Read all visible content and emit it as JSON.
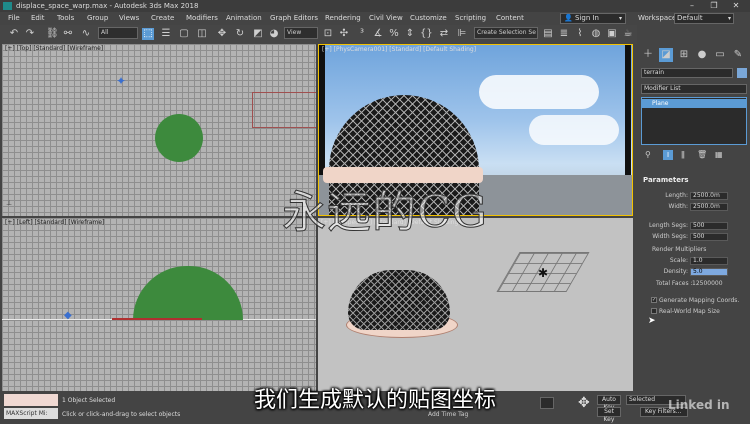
{
  "window": {
    "title": "displace_space_warp.max - Autodesk 3ds Max 2018",
    "minimize": "–",
    "restore": "❐",
    "close": "✕"
  },
  "menu": {
    "items": [
      "File",
      "Edit",
      "Tools",
      "Group",
      "Views",
      "Create",
      "Modifiers",
      "Animation",
      "Graph Editors",
      "Rendering",
      "Civil View",
      "Customize",
      "Scripting",
      "Content"
    ],
    "sign_in": "Sign In",
    "workspaces_label": "Workspaces:",
    "workspace_value": "Default"
  },
  "toolbar": {
    "filter_value": "All",
    "view_value": "View",
    "selection_set": "Create Selection Se"
  },
  "viewports": {
    "top_left_label": "[+] [Top] [Standard] [Wireframe]",
    "top_right_label": "[+] [PhysCamera001] [Standard] [Default Shading]",
    "bottom_left_label": "[+] [Left] [Standard] [Wireframe]",
    "bottom_right_label": "[+] [Perspective] [Standard] [Default Shading]"
  },
  "command_panel": {
    "object_name": "terrain",
    "modifier_list": "Modifier List",
    "stack_item": "Plane",
    "rollout_title": "Parameters",
    "length_label": "Length:",
    "length_value": "2500.0m",
    "width_label": "Width:",
    "width_value": "2500.0m",
    "length_segs_label": "Length Segs:",
    "length_segs_value": "500",
    "width_segs_label": "Width Segs:",
    "width_segs_value": "500",
    "render_mult_label": "Render Multipliers",
    "scale_label": "Scale:",
    "scale_value": "1.0",
    "density_label": "Density:",
    "density_value": "5.0",
    "total_faces_label": "Total Faces :",
    "total_faces_value": "12500000",
    "gen_mapping_label": "Generate Mapping Coords.",
    "real_world_label": "Real-World Map Size"
  },
  "status": {
    "maxscript_label": "MAXScript Mi:",
    "selected_text": "1 Object Selected",
    "hint_text": "Click or click-and-drag to select objects",
    "auto_key": "Auto Key",
    "set_key": "Set Key",
    "selected_dropdown": "Selected",
    "key_filters": "Key Filters...",
    "add_time_tag": "Add Time Tag"
  },
  "overlay": {
    "subtitle": "我们生成默认的贴图坐标",
    "watermark": "永远的CG",
    "brand": "Linked in"
  },
  "colors": {
    "accent_blue": "#5b9bd5",
    "viewport_active": "#ffd700",
    "sphere": "#3d8a3d"
  }
}
